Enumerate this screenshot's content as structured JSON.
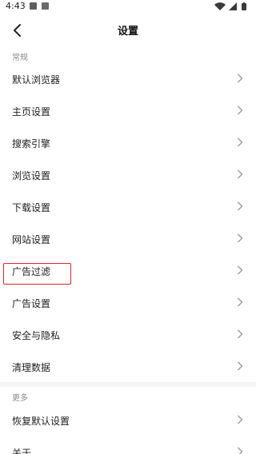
{
  "status_bar": {
    "time": "4:43",
    "icons": [
      "notification-square-icon",
      "notification-app-icon",
      "wifi-icon",
      "signal-icon",
      "battery-icon"
    ]
  },
  "header": {
    "title": "设置",
    "back_icon": "back-arrow-icon"
  },
  "sections": [
    {
      "title": "常规",
      "items": [
        {
          "label": "默认浏览器"
        },
        {
          "label": "主页设置"
        },
        {
          "label": "搜索引擎"
        },
        {
          "label": "浏览设置"
        },
        {
          "label": "下载设置"
        },
        {
          "label": "网站设置"
        },
        {
          "label": "广告过滤",
          "highlighted": true
        },
        {
          "label": "广告设置"
        },
        {
          "label": "安全与隐私"
        },
        {
          "label": "清理数据"
        }
      ]
    },
    {
      "title": "更多",
      "items": [
        {
          "label": "恢复默认设置"
        },
        {
          "label": "关于"
        }
      ]
    }
  ],
  "colors": {
    "highlight": "#d9262f",
    "section_title": "#8a8a8a",
    "text": "#222222",
    "chevron": "#9a9a9a"
  }
}
